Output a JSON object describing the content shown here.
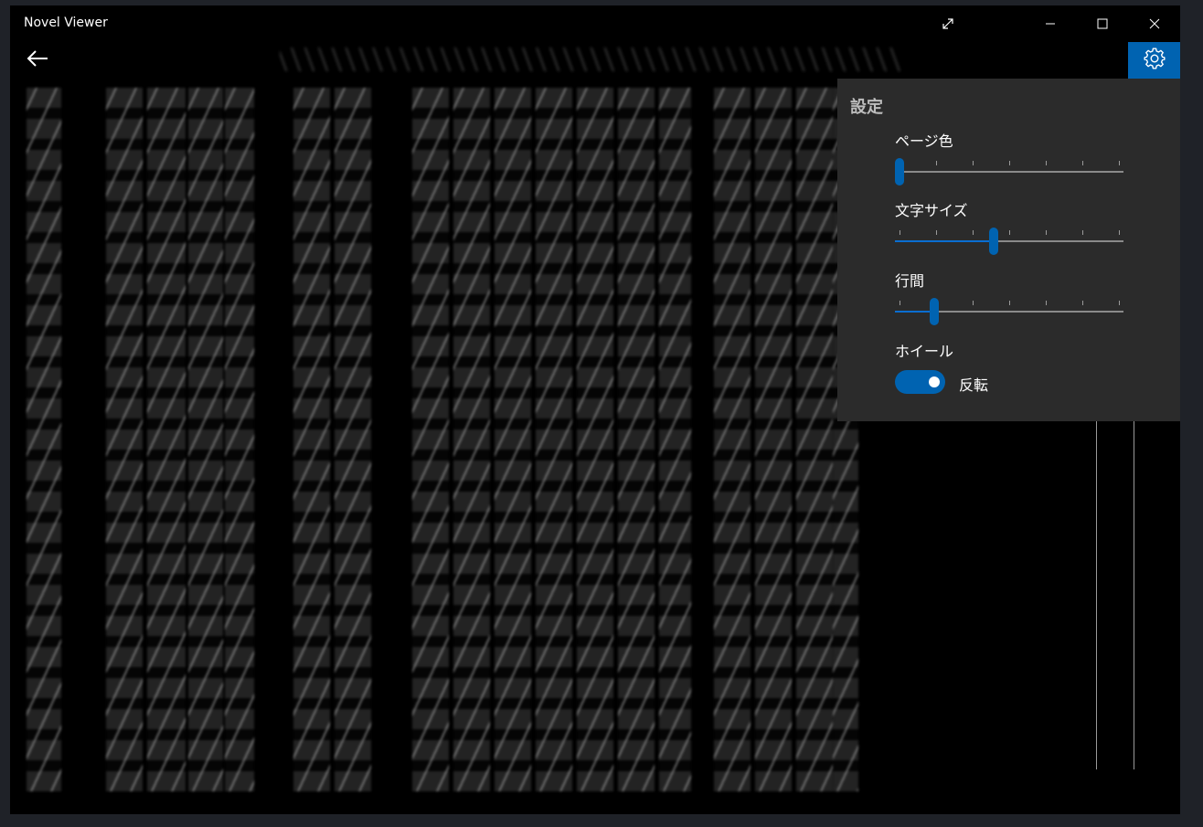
{
  "window": {
    "title": "Novel Viewer"
  },
  "titlebar_buttons": [
    {
      "name": "fullscreen-button",
      "icon": "expand-diagonal-icon"
    },
    {
      "name": "minimize-button",
      "icon": "minimize-icon"
    },
    {
      "name": "maximize-button",
      "icon": "maximize-icon"
    },
    {
      "name": "close-button",
      "icon": "close-icon"
    }
  ],
  "nav": {
    "back_icon": "arrow-left-icon",
    "settings_icon": "gear-icon"
  },
  "settings": {
    "title": "設定",
    "page_color": {
      "label": "ページ色",
      "value_fraction": 0.0,
      "ticks": 6
    },
    "font_size": {
      "label": "文字サイズ",
      "value_fraction": 0.43,
      "ticks": 6
    },
    "line_spacing": {
      "label": "行間",
      "value_fraction": 0.16,
      "ticks": 6
    },
    "wheel": {
      "label": "ホイール",
      "toggle_label": "反転",
      "on": true
    }
  },
  "colors": {
    "accent": "#0063b1",
    "panel_bg": "#2b2b2b",
    "page_bg": "#000000",
    "desktop_bg": "#1f2228"
  }
}
